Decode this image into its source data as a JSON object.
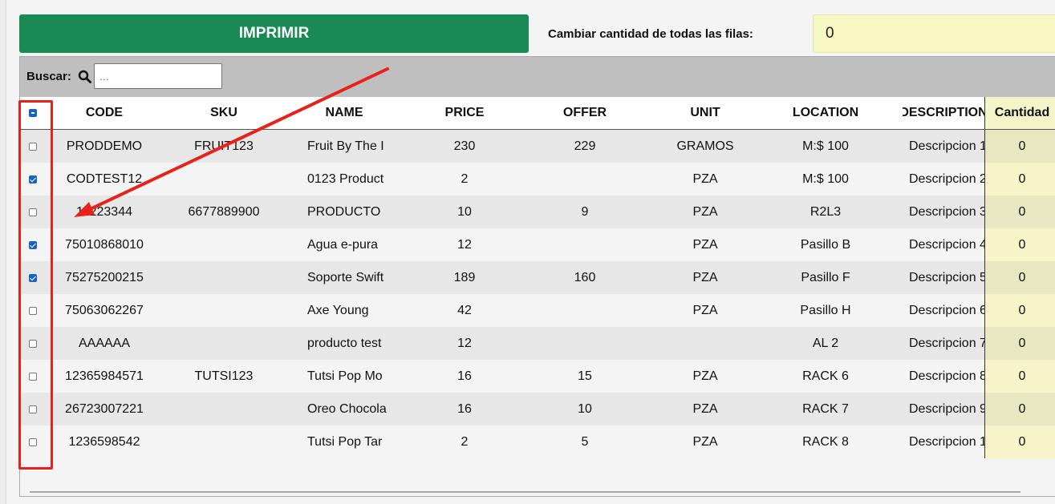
{
  "toolbar": {
    "print_label": "IMPRIMIR",
    "change_qty_label": "Cambiar cantidad de todas las filas:",
    "change_qty_value": "0"
  },
  "search": {
    "label": "Buscar:",
    "placeholder": "..."
  },
  "table": {
    "headers": {
      "select_all": "indeterminate",
      "code": "CODE",
      "sku": "SKU",
      "name": "NAME",
      "price": "PRICE",
      "offer": "OFFER",
      "unit": "UNIT",
      "location": "LOCATION",
      "description": "DESCRIPTION",
      "cantidad": "Cantidad"
    },
    "rows": [
      {
        "checked": false,
        "code": "PRODDEMO",
        "sku": "FRUIT123",
        "name": "Fruit By The I",
        "price": "230",
        "offer": "229",
        "unit": "GRAMOS",
        "location": "M:$ 100",
        "description": "Descripcion 1",
        "cantidad": "0"
      },
      {
        "checked": true,
        "code": "CODTEST12",
        "sku": "",
        "name": "0123 Product",
        "price": "2",
        "offer": "",
        "unit": "PZA",
        "location": "M:$ 100",
        "description": "Descripcion 2",
        "cantidad": "0"
      },
      {
        "checked": false,
        "code": "11223344",
        "sku": "6677889900",
        "name": "PRODUCTO",
        "price": "10",
        "offer": "9",
        "unit": "PZA",
        "location": "R2L3",
        "description": "Descripcion 3",
        "cantidad": "0"
      },
      {
        "checked": true,
        "code": "75010868010",
        "sku": "",
        "name": "Agua e-pura",
        "price": "12",
        "offer": "",
        "unit": "PZA",
        "location": "Pasillo B",
        "description": "Descripcion 4",
        "cantidad": "0"
      },
      {
        "checked": true,
        "code": "75275200215",
        "sku": "",
        "name": "Soporte Swift",
        "price": "189",
        "offer": "160",
        "unit": "PZA",
        "location": "Pasillo F",
        "description": "Descripcion 5",
        "cantidad": "0"
      },
      {
        "checked": false,
        "code": "75063062267",
        "sku": "",
        "name": "Axe Young",
        "price": "42",
        "offer": "",
        "unit": "PZA",
        "location": "Pasillo H",
        "description": "Descripcion 6",
        "cantidad": "0"
      },
      {
        "checked": false,
        "code": "AAAAAA",
        "sku": "",
        "name": "producto test",
        "price": "12",
        "offer": "",
        "unit": "",
        "location": "AL 2",
        "description": "Descripcion 7",
        "cantidad": "0"
      },
      {
        "checked": false,
        "code": "12365984571",
        "sku": "TUTSI123",
        "name": "Tutsi Pop Mo",
        "price": "16",
        "offer": "15",
        "unit": "PZA",
        "location": "RACK 6",
        "description": "Descripcion 8",
        "cantidad": "0"
      },
      {
        "checked": false,
        "code": "26723007221",
        "sku": "",
        "name": "Oreo Chocola",
        "price": "16",
        "offer": "10",
        "unit": "PZA",
        "location": "RACK 7",
        "description": "Descripcion 9",
        "cantidad": "0"
      },
      {
        "checked": false,
        "code": "1236598542",
        "sku": "",
        "name": "Tutsi Pop Tar",
        "price": "2",
        "offer": "5",
        "unit": "PZA",
        "location": "RACK 8",
        "description": "Descripcion 1",
        "cantidad": "0"
      }
    ]
  },
  "icons": {
    "search": "search-icon"
  },
  "colors": {
    "print_button": "#1a8a55",
    "quantity_field": "#f7f7c4",
    "checkbox_checked": "#1565c0",
    "annotation_red": "#e8221b"
  }
}
